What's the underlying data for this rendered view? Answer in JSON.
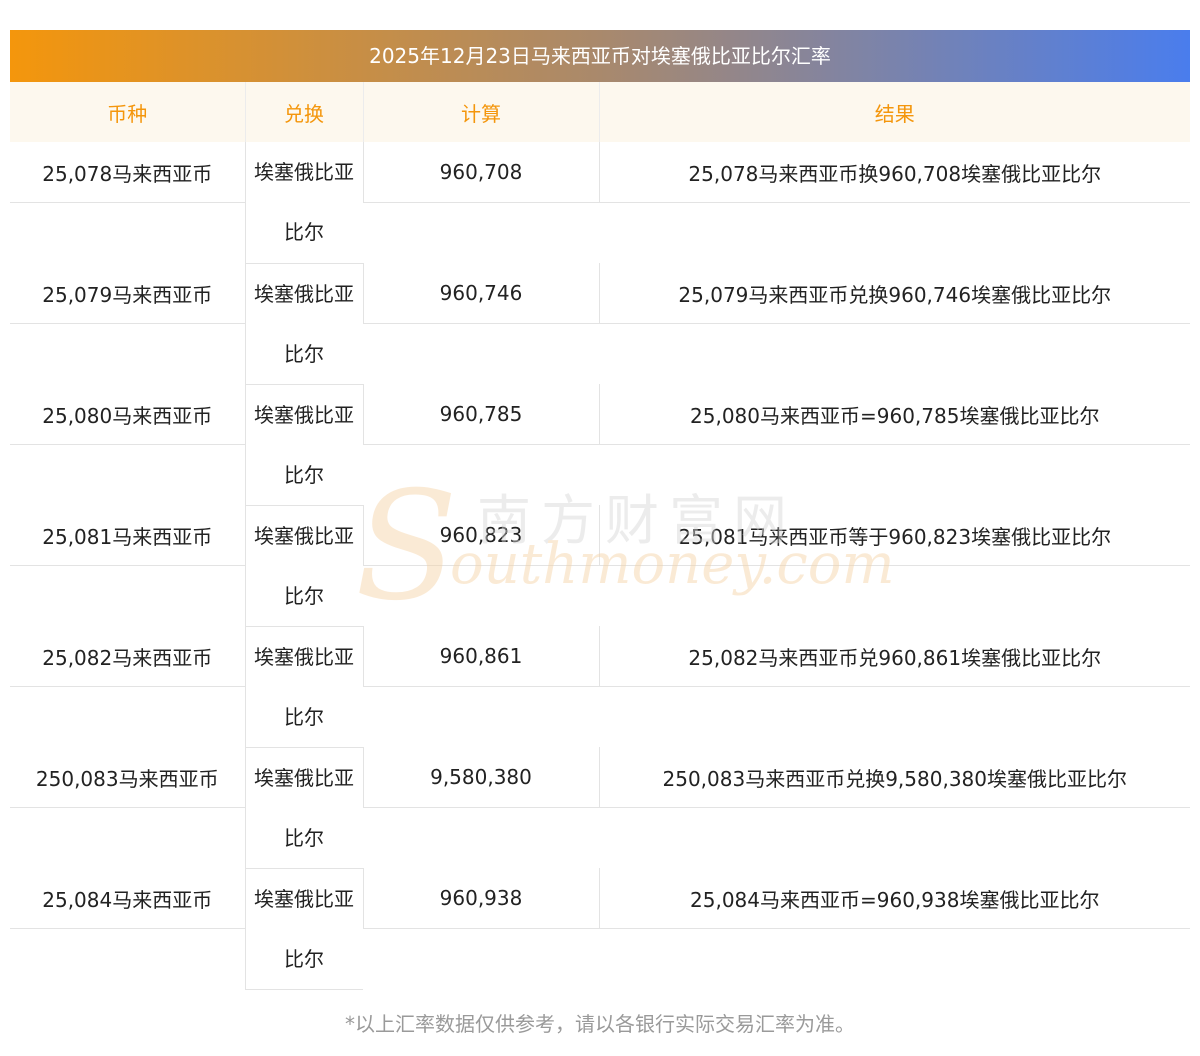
{
  "title": "2025年12月23日马来西亚币对埃塞俄比亚比尔汇率",
  "headers": [
    "币种",
    "兑换",
    "计算",
    "结果"
  ],
  "currency_line1": "埃塞俄比亚",
  "currency_line2": "比尔",
  "rows": [
    {
      "amount": "25,078马来西亚币",
      "calc": "960,708",
      "result": "25,078马来西亚币换960,708埃塞俄比亚比尔"
    },
    {
      "amount": "25,079马来西亚币",
      "calc": "960,746",
      "result": "25,079马来西亚币兑换960,746埃塞俄比亚比尔"
    },
    {
      "amount": "25,080马来西亚币",
      "calc": "960,785",
      "result": "25,080马来西亚币=960,785埃塞俄比亚比尔"
    },
    {
      "amount": "25,081马来西亚币",
      "calc": "960,823",
      "result": "25,081马来西亚币等于960,823埃塞俄比亚比尔"
    },
    {
      "amount": "25,082马来西亚币",
      "calc": "960,861",
      "result": "25,082马来西亚币兑960,861埃塞俄比亚比尔"
    },
    {
      "amount": "250,083马来西亚币",
      "calc": "9,580,380",
      "result": "250,083马来西亚币兑换9,580,380埃塞俄比亚比尔"
    },
    {
      "amount": "25,084马来西亚币",
      "calc": "960,938",
      "result": "25,084马来西亚币=960,938埃塞俄比亚比尔"
    }
  ],
  "watermark": {
    "cn": "南方财富网",
    "en": "outhmoney.com",
    "s": "S"
  },
  "note": "*以上汇率数据仅供参考，请以各银行实际交易汇率为准。",
  "colors": {
    "accent": "#f4960c",
    "gradient_end": "#4a7ded",
    "header_bg": "#fdf8ee"
  }
}
